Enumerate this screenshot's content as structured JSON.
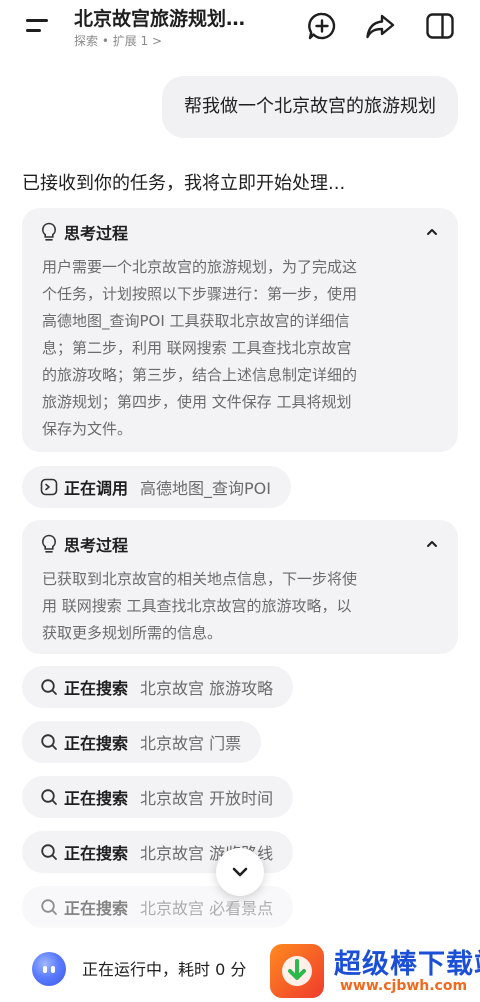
{
  "header": {
    "title": "北京故宫旅游规划…",
    "breadcrumb": "探索 • 扩展 1 >"
  },
  "user_message": "帮我做一个北京故宫的旅游规划",
  "ack_message": "已接收到你的任务，我将立即开始处理...",
  "thinking": [
    {
      "label": "思考过程",
      "lines": [
        "用户需要一个北京故宫的旅游规划，为了完成这",
        "个任务，计划按照以下步骤进行：第一步，使用",
        "高德地图_查询POI 工具获取北京故宫的详细信",
        "息；第二步，利用 联网搜索 工具查找北京故宫",
        "的旅游攻略；第三步，结合上述信息制定详细的",
        "旅游规划；第四步，使用 文件保存 工具将规划",
        "保存为文件。"
      ]
    },
    {
      "label": "思考过程",
      "lines": [
        "已获取到北京故宫的相关地点信息，下一步将使",
        "用 联网搜索 工具查找北京故宫的旅游攻略，以",
        "获取更多规划所需的信息。"
      ]
    }
  ],
  "tool_call": {
    "action": "正在调用",
    "target": "高德地图_查询POI"
  },
  "searches": [
    {
      "action": "正在搜索",
      "query": "北京故宫 旅游攻略"
    },
    {
      "action": "正在搜索",
      "query": "北京故宫 门票"
    },
    {
      "action": "正在搜索",
      "query": "北京故宫 开放时间"
    },
    {
      "action": "正在搜索",
      "query": "北京故宫 游览路线"
    },
    {
      "action": "正在搜索",
      "query": "北京故宫 必看景点"
    }
  ],
  "bottom": {
    "status": "正在运行中，耗时 0 分"
  },
  "watermark": {
    "name": "超级棒下载站",
    "url": "www.cjbwh.com"
  }
}
